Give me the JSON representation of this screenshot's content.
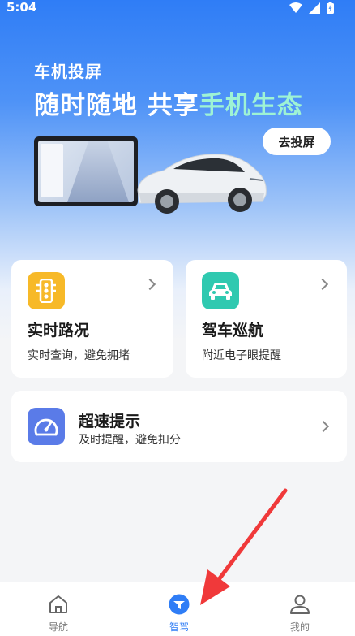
{
  "status_bar": {
    "time": "5:04"
  },
  "hero": {
    "subtitle": "车机投屏",
    "title_main": "随时随地 共享",
    "title_highlight": "手机生态",
    "cast_button": "去投屏"
  },
  "cards": {
    "traffic": {
      "title": "实时路况",
      "desc": "实时查询，避免拥堵",
      "icon": "traffic-light-icon",
      "color": "#f7b928"
    },
    "cruise": {
      "title": "驾车巡航",
      "desc": "附近电子眼提醒",
      "icon": "car-icon",
      "color": "#2fc9b0"
    },
    "speed": {
      "title": "超速提示",
      "desc": "及时提醒，避免扣分",
      "icon": "speedometer-icon",
      "color": "#5a7be8"
    }
  },
  "bottom_nav": {
    "items": [
      {
        "label": "导航",
        "icon": "home-icon",
        "active": false
      },
      {
        "label": "智驾",
        "icon": "drive-icon",
        "active": true
      },
      {
        "label": "我的",
        "icon": "user-icon",
        "active": false
      }
    ],
    "active_color": "#2f7df6"
  },
  "annotation": {
    "color": "#f0393a"
  }
}
